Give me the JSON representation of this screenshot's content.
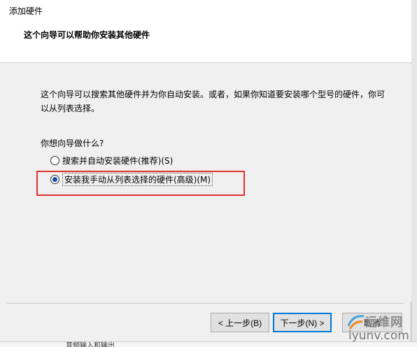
{
  "window": {
    "title": "添加硬件"
  },
  "header": {
    "title": "这个向导可以帮助你安装其他硬件"
  },
  "content": {
    "description": "这个向导可以搜索其他硬件并为你自动安装。或者，如果你知道要安装哪个型号的硬件，你可以从列表选择。",
    "prompt": "你想向导做什么?",
    "options": [
      {
        "label": "搜索并自动安装硬件(推荐)(S)",
        "checked": false
      },
      {
        "label": "安装我手动从列表选择的硬件(高级)(M)",
        "checked": true
      }
    ]
  },
  "buttons": {
    "back": "< 上一步(B)",
    "next": "下一步(N) >",
    "cancel": "取消"
  },
  "background_window": {
    "text": "音频输入和输出"
  },
  "watermark": {
    "title": "运维网",
    "url": "iyunv.com"
  },
  "colors": {
    "highlight": "#e0322e",
    "radio_selected": "#1a4da8",
    "default_button_border": "#0078d7"
  }
}
